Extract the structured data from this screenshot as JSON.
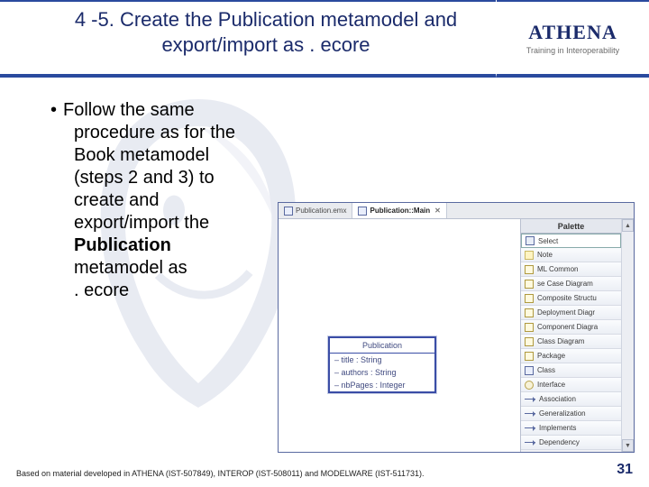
{
  "header": {
    "title_line1": "4 -5. Create the Publication metamodel and",
    "title_line2": "export/import as . ecore",
    "brand": "ATHENA",
    "brand_tagline": "Training in Interoperability"
  },
  "bullet": {
    "lead": "•",
    "l1": "Follow the same",
    "l2": "procedure as for the",
    "l3": "Book metamodel",
    "l4": "(steps 2 and 3) to",
    "l5": "create and",
    "l6": "export/import the",
    "l7_bold": "Publication",
    "l8": "metamodel as",
    "l9": ". ecore"
  },
  "screenshot": {
    "tabs": {
      "t1": "Publication.emx",
      "t2": "Publication::Main"
    },
    "uml": {
      "title": "Publication",
      "a1": "– title : String",
      "a2": "– authors : String",
      "a3": "– nbPages : Integer"
    },
    "palette": {
      "header": "Palette",
      "items": {
        "select": "Select",
        "note": "Note",
        "common": "ML Common",
        "usecase": "se Case Diagram",
        "composite": "Composite Structu",
        "deployment": "Deployment Diagr",
        "component": "Component Diagra",
        "classdgm": "Class Diagram",
        "package": "Package",
        "class": "Class",
        "interface": "Interface",
        "association": "Association",
        "generalization": "Generalization",
        "implements": "Implements",
        "dependency": "Dependency"
      }
    }
  },
  "footer": {
    "credit": "Based on material developed in ATHENA (IST-507849), INTEROP (IST-508011) and MODELWARE (IST-511731).",
    "page": "31"
  }
}
